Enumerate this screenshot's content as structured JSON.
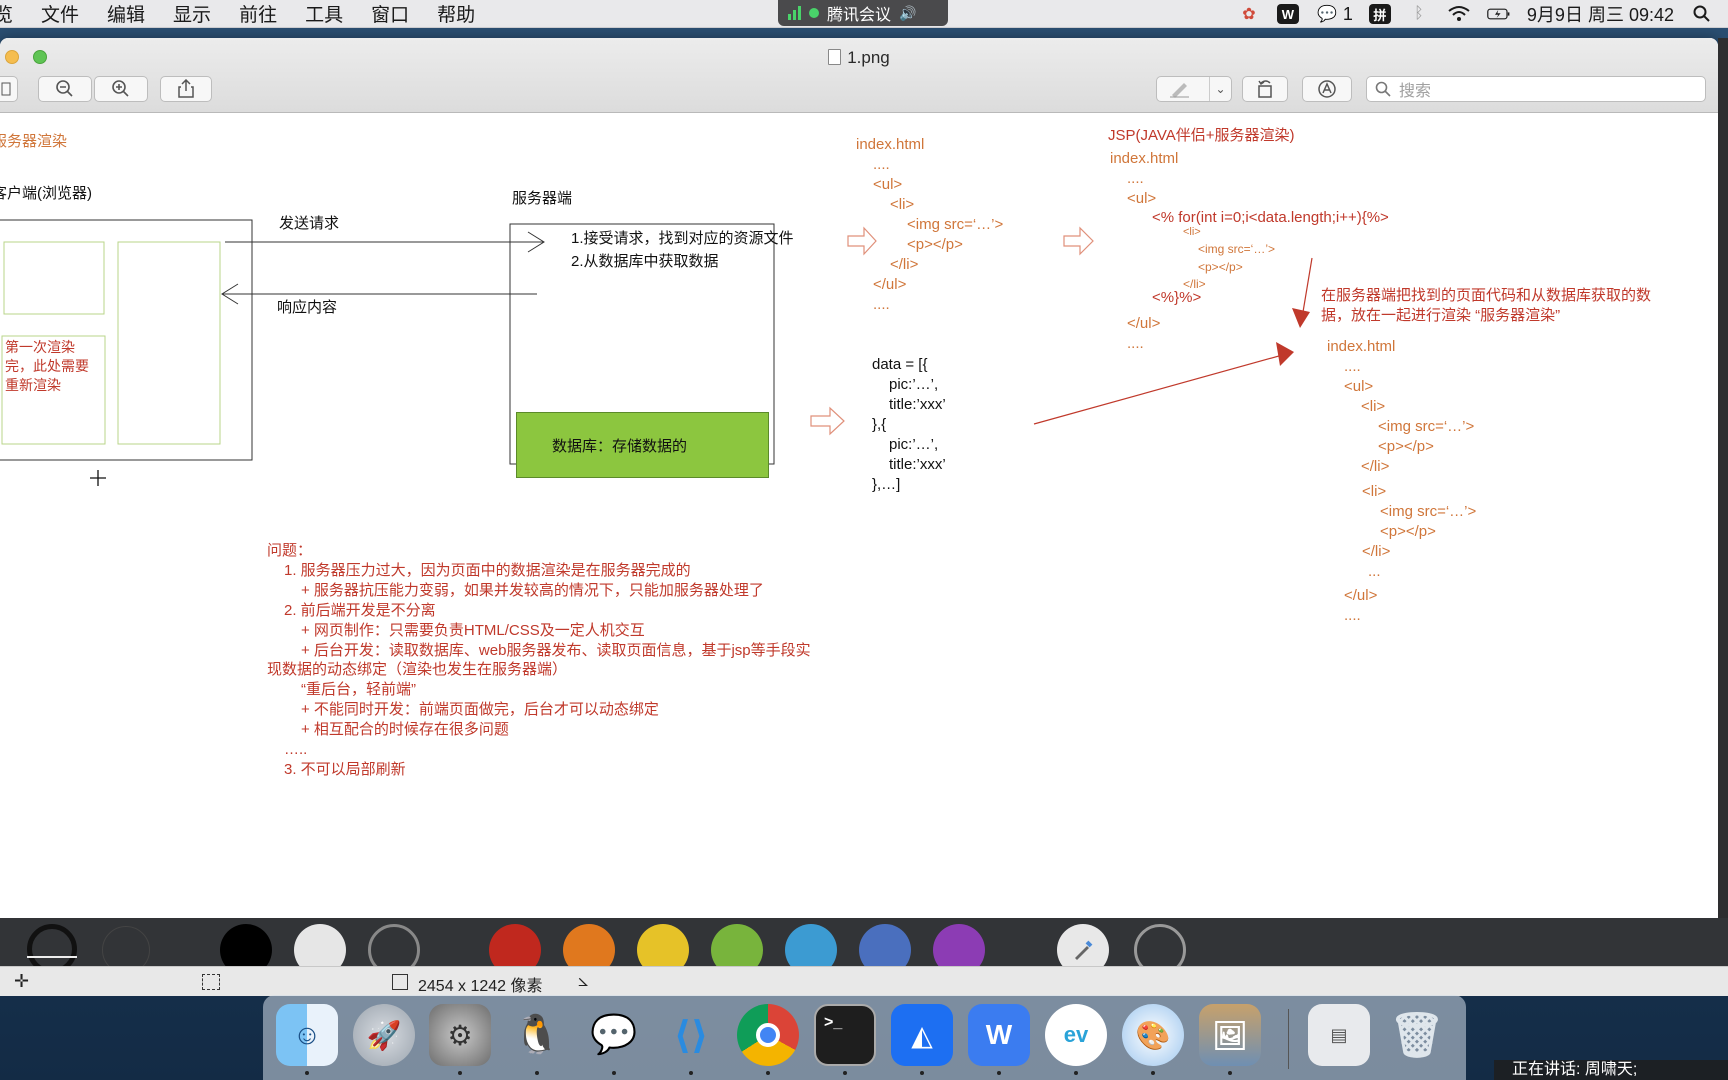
{
  "menubar": {
    "items": [
      "览",
      "文件",
      "编辑",
      "显示",
      "前往",
      "工具",
      "窗口",
      "帮助"
    ],
    "meeting_label": "腾讯会议",
    "wechat_count": "1",
    "input_method": "拼",
    "datetime": "9月9日 周三  09:42"
  },
  "window": {
    "title": "1.png",
    "search_placeholder": "搜索"
  },
  "diagram": {
    "heading": "服务器渲染",
    "client_label": "客户端(浏览器)",
    "server_label": "服务器端",
    "send_request": "发送请求",
    "response": "响应内容",
    "rerender_note": [
      "第一次渲染",
      "完，此处需要",
      "重新渲染"
    ],
    "server_steps": [
      "1.接受请求，找到对应的资源文件",
      "2.从数据库中获取数据"
    ],
    "database": "数据库：存储数据的",
    "index_html_lines": [
      "index.html",
      "....",
      "<ul>",
      "<li>",
      "<img src=‘…’>",
      "<p></p>",
      "</li>",
      "</ul>",
      "...."
    ],
    "data_lines": [
      "data = [{",
      "pic:’…’,",
      "title:’xxx’",
      "},{",
      "pic:’…’,",
      "title:’xxx’",
      "},…]"
    ],
    "jsp_title": "JSP(JAVA伴侣+服务器渲染)",
    "jsp_lines": [
      "index.html",
      "....",
      "<ul>",
      "<% for(int i=0;i<data.length;i++){%>",
      "<li>",
      "<img src=‘…’>",
      "<p></p>",
      "</li>",
      "<%}%>",
      "</ul>",
      "...."
    ],
    "render_note": [
      "在服务器端把找到的页面代码和从数据库获取的数",
      "据，放在一起进行渲染 “服务器渲染”"
    ],
    "result_lines": [
      "index.html",
      "....",
      "<ul>",
      "<li>",
      "<img src=‘…’>",
      "<p></p>",
      "</li>",
      "<li>",
      "<img src=‘…’>",
      "<p></p>",
      "</li>",
      "...",
      "</ul>",
      "...."
    ],
    "problems": [
      "问题：",
      "1. 服务器压力过大，因为页面中的数据渲染是在服务器完成的",
      "+ 服务器抗压能力变弱，如果并发较高的情况下，只能加服务器处理了",
      "2. 前后端开发是不分离",
      "+ 网页制作：只需要负责HTML/CSS及一定人机交互",
      "+ 后台开发：读取数据库、web服务器发布、读取页面信息，基于jsp等手段实",
      "现数据的动态绑定（渲染也发生在服务器端）",
      "“重后台，轻前端”",
      "+ 不能同时开发：前端页面做完，后台才可以动态绑定",
      "+ 相互配合的时候存在很多问题",
      "…..",
      "3. 不可以局部刷新"
    ]
  },
  "markup": {
    "colors": [
      "#000000",
      "#e6e6e6",
      "#323437",
      "#c0281e",
      "#e0781e",
      "#e6c228",
      "#78b43c",
      "#3c9bd2",
      "#4a6fbe",
      "#8c3cb4"
    ]
  },
  "statusbar": {
    "dimensions": "2454 x 1242 像素"
  },
  "dock": {
    "apps": [
      "Finder",
      "Launchpad",
      "系统偏好设置",
      "QQ",
      "微信",
      "Visual Studio Code",
      "Chrome",
      "终端",
      "腾讯会议",
      "WPS",
      "EV录屏",
      "画图",
      "预览",
      "网络",
      "废纸篓"
    ]
  },
  "speaking_label": "正在讲话: 周啸天;"
}
